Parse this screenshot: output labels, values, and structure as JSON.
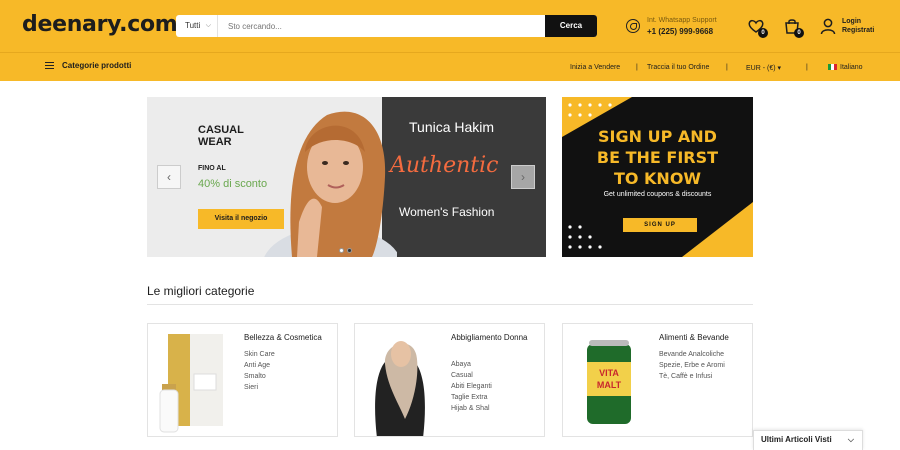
{
  "header": {
    "logo": "deenary.com",
    "search": {
      "category": "Tutti",
      "placeholder": "Sto cercando...",
      "button": "Cerca"
    },
    "support": {
      "label": "Int. Whatsapp Support",
      "phone": "+1 (225) 999-9668"
    },
    "wishlist_count": "0",
    "cart_count": "0",
    "login": {
      "line1": "Login",
      "line2": "Registrati"
    }
  },
  "nav": {
    "categories": "Categorie prodotti",
    "links": [
      "Inizia a Vendere",
      "Traccia il tuo Ordine",
      "EUR - (€)",
      "Italiano"
    ],
    "separator": "|"
  },
  "slider": {
    "title": "CASUAL WEAR",
    "upto": "FINO AL",
    "discount": "40% di sconto",
    "cta": "Visita il negozio",
    "right_title": "Tunica Hakim",
    "right_script": "Authentic",
    "right_sub": "Women's Fashion",
    "prev": "‹",
    "next": "›"
  },
  "promo": {
    "heading_1": "SIGN UP AND",
    "heading_2": "BE THE FIRST",
    "heading_3": "TO KNOW",
    "sub": "Get unlimited coupons & discounts",
    "button": "SIGN UP"
  },
  "section_title": "Le migliori categorie",
  "categories": [
    {
      "title": "Bellezza & Cosmetica",
      "items": [
        "Skin Care",
        "Anti Age",
        "Smalto",
        "Sieri"
      ]
    },
    {
      "title": "Abbigliamento Donna",
      "items": [
        "Abaya",
        "Casual",
        "Abiti Eleganti",
        "Taglie Extra",
        "Hijab & Shal"
      ]
    },
    {
      "title": "Alimenti & Bevande",
      "items": [
        "Bevande Analcoliche",
        "Spezie, Erbe e Aromi",
        "Tè, Caffè e Infusi"
      ]
    }
  ],
  "recent": {
    "label": "Ultimi Articoli Visti",
    "chevron": "⌵"
  },
  "colors": {
    "brand_yellow": "#f7b928",
    "dark": "#111111",
    "accent_green": "#6aa84f",
    "accent_orange": "#f46b3f"
  }
}
